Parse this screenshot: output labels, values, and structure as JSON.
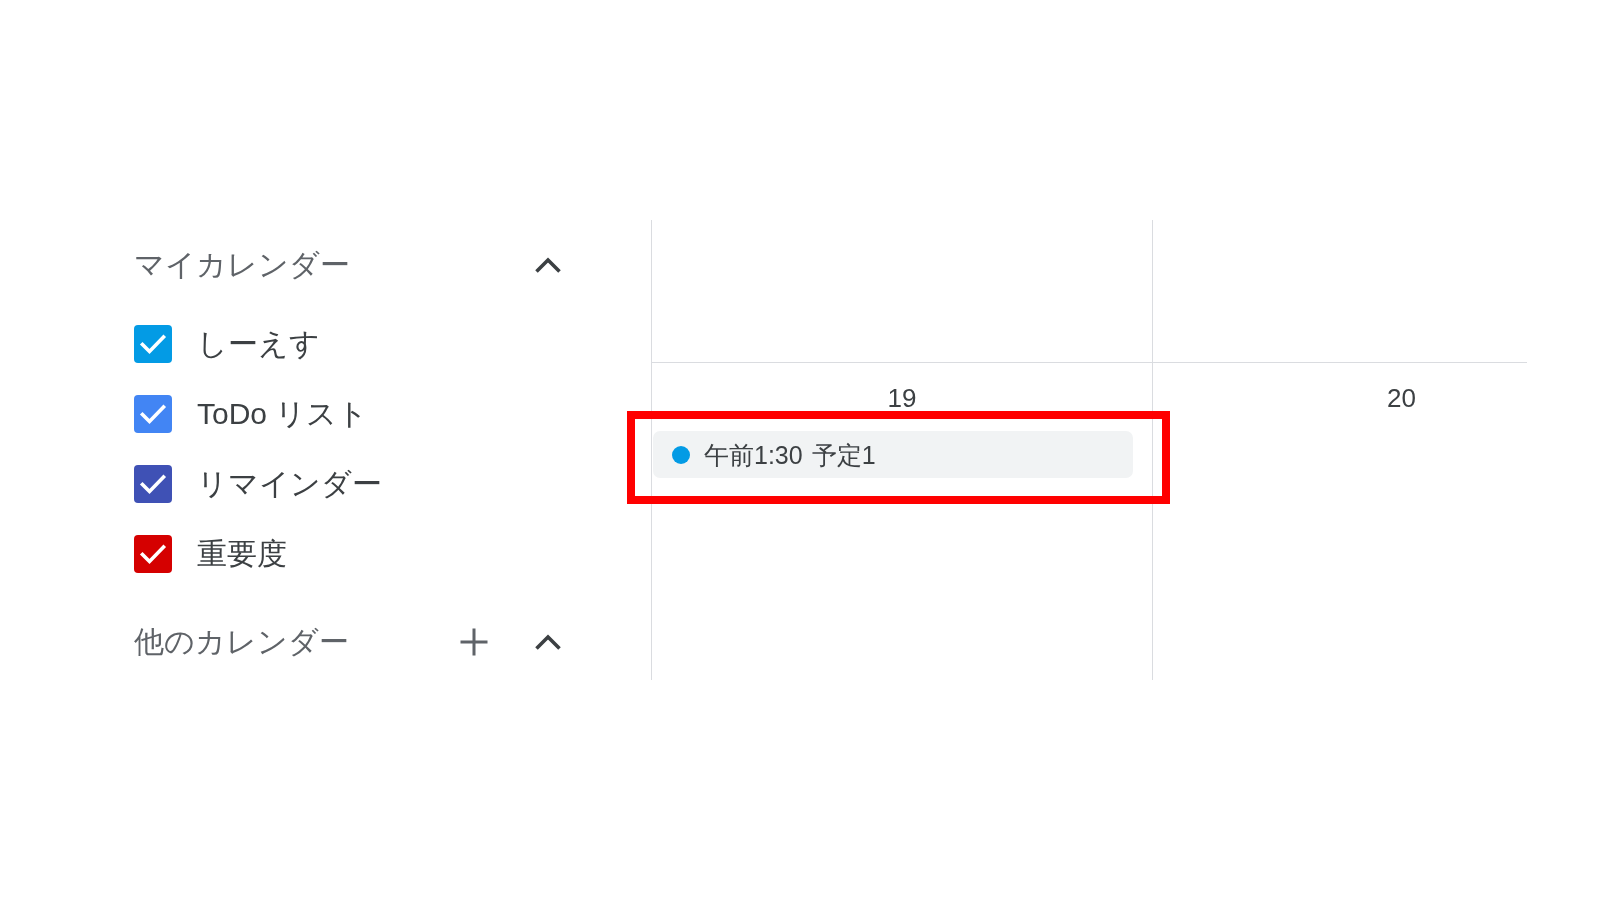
{
  "sidebar": {
    "sections": [
      {
        "title": "マイカレンダー",
        "expanded": true,
        "calendars": [
          {
            "label": "しーえす",
            "checked": true,
            "color": "#039be5"
          },
          {
            "label": "ToDo リスト",
            "checked": true,
            "color": "#4285f4"
          },
          {
            "label": "リマインダー",
            "checked": true,
            "color": "#3f51b5"
          },
          {
            "label": "重要度",
            "checked": true,
            "color": "#d50000"
          }
        ]
      },
      {
        "title": "他のカレンダー",
        "expanded": true,
        "add_button": true
      }
    ]
  },
  "calendar": {
    "days": [
      {
        "label": "19",
        "events": [
          {
            "time": "午前1:30",
            "title": "予定1",
            "color": "#039be5",
            "highlighted": true
          }
        ]
      },
      {
        "label": "20"
      }
    ]
  }
}
